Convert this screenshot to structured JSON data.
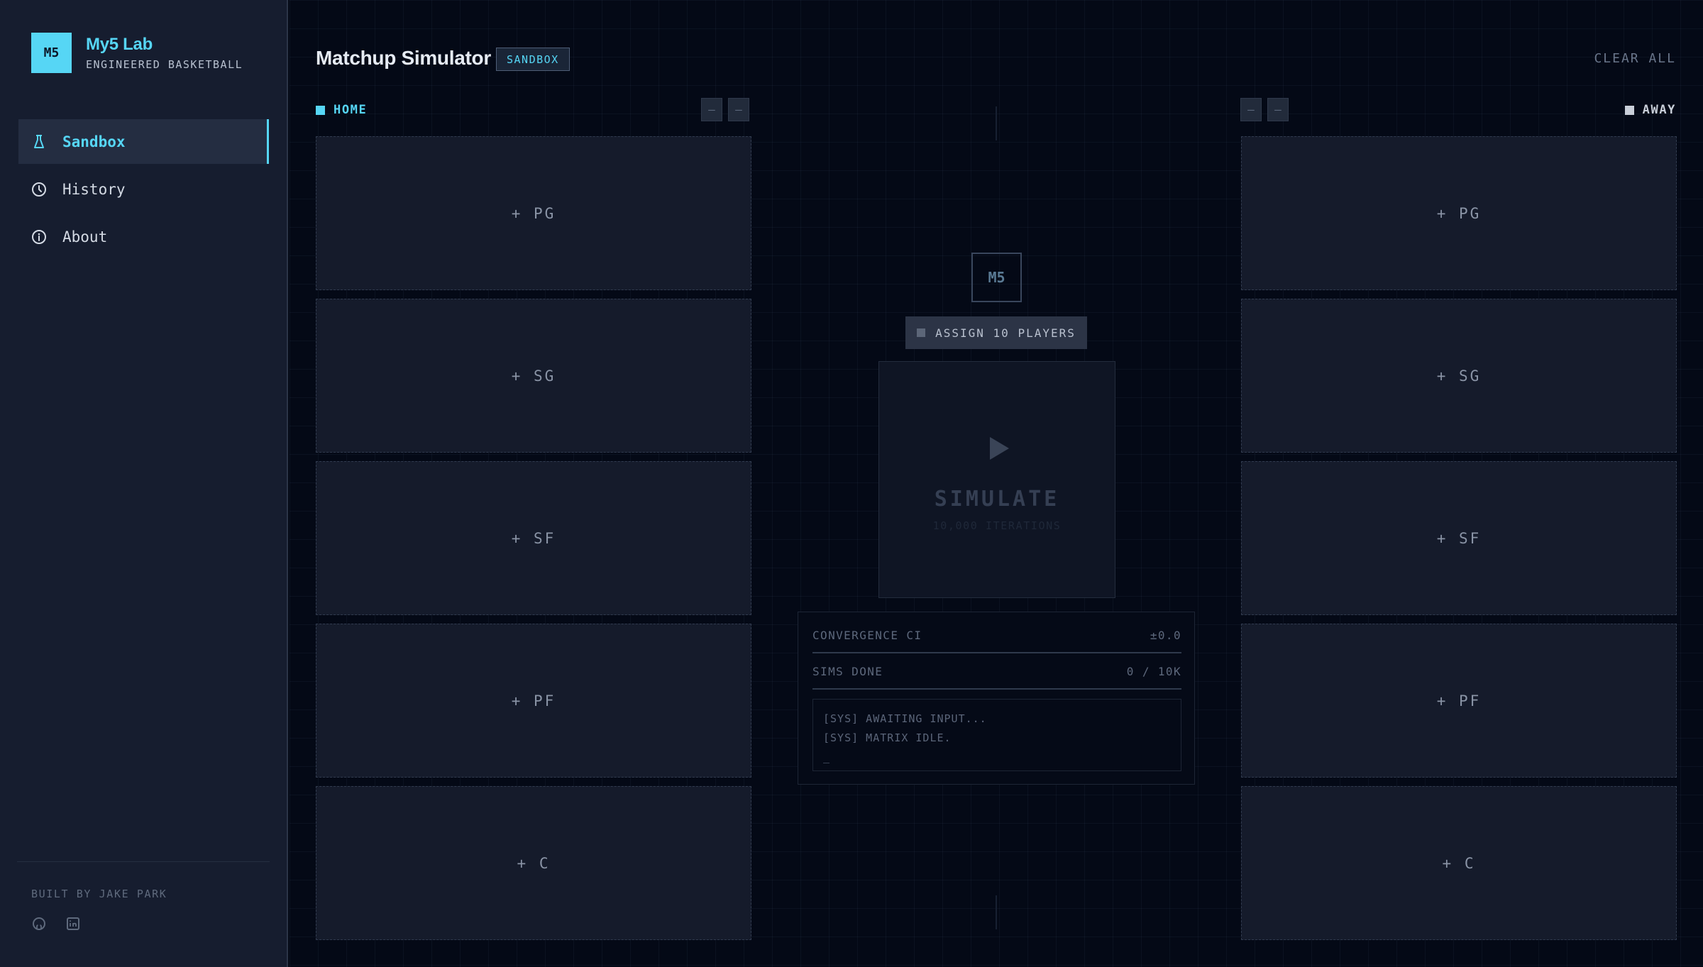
{
  "brand": {
    "logo": "M5",
    "title": "My5 Lab",
    "subtitle": "ENGINEERED BASKETBALL"
  },
  "nav": {
    "items": [
      {
        "label": "Sandbox",
        "icon": "flask-icon",
        "active": true
      },
      {
        "label": "History",
        "icon": "clock-icon",
        "active": false
      },
      {
        "label": "About",
        "icon": "info-icon",
        "active": false
      }
    ]
  },
  "footer": {
    "built_by": "BUILT BY JAKE PARK",
    "links": [
      "github-icon",
      "linkedin-icon"
    ]
  },
  "header": {
    "title": "Matchup Simulator",
    "badge": "SANDBOX",
    "clear_all": "CLEAR ALL"
  },
  "home": {
    "label": "HOME",
    "color": "#56d6f5",
    "controls": [
      "–",
      "–"
    ],
    "slots": [
      "+ PG",
      "+ SG",
      "+ SF",
      "+ PF",
      "+ C"
    ]
  },
  "away": {
    "label": "AWAY",
    "color": "#c9cfd9",
    "controls": [
      "–",
      "–"
    ],
    "slots": [
      "+ PG",
      "+ SG",
      "+ SF",
      "+ PF",
      "+ C"
    ]
  },
  "center": {
    "logo": "M5",
    "assign_button": "ASSIGN 10 PLAYERS",
    "simulate_label": "SIMULATE",
    "iterations": "10,000 ITERATIONS"
  },
  "stats": {
    "convergence_label": "CONVERGENCE CI",
    "convergence_value": "±0.0",
    "sims_label": "SIMS DONE",
    "sims_value": "0 / 10K"
  },
  "log": {
    "lines": [
      "[SYS] AWAITING INPUT...",
      "[SYS] MATRIX IDLE."
    ],
    "cursor": "_"
  },
  "colors": {
    "accent": "#56d6f5",
    "sidebar_bg": "#161d2f",
    "main_bg": "#040916"
  }
}
